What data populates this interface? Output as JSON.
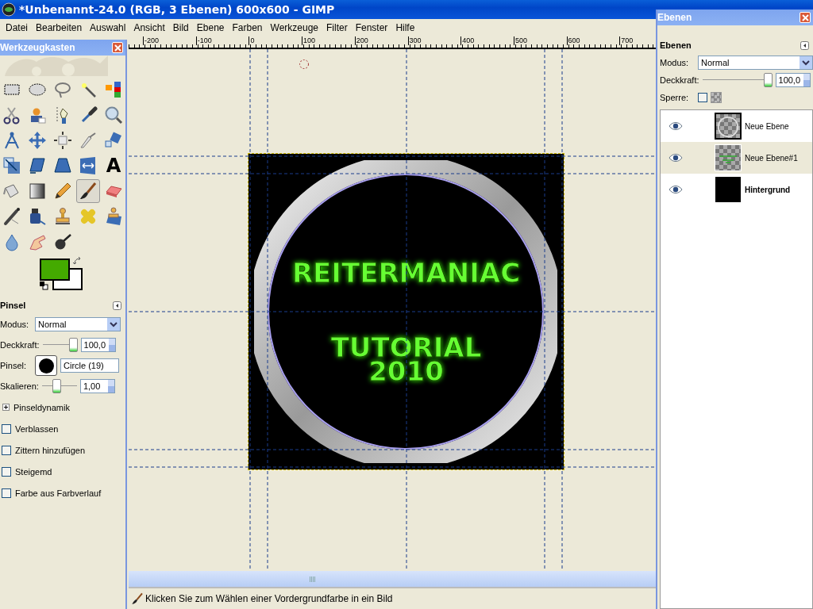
{
  "window": {
    "title": "*Unbenannt-24.0 (RGB, 3 Ebenen) 600x600 - GIMP"
  },
  "menu": [
    "Datei",
    "Bearbeiten",
    "Auswahl",
    "Ansicht",
    "Bild",
    "Ebene",
    "Farben",
    "Werkzeuge",
    "Filter",
    "Fenster",
    "Hilfe"
  ],
  "ruler": [
    "-200",
    "-100",
    "0",
    "100",
    "200",
    "300",
    "400",
    "500",
    "600",
    "700"
  ],
  "canvas": {
    "texts": [
      "REITERMANIAC",
      "TUTORIAL",
      "2010"
    ]
  },
  "status_bar": "Klicken Sie zum Wählen einer Vordergrundfarbe in ein Bild",
  "toolbox": {
    "title": "Werkzeugkasten",
    "tools": [
      {
        "selected": false
      },
      {
        "selected": false
      },
      {
        "selected": false
      },
      {
        "selected": false
      },
      {
        "selected": false
      },
      {
        "selected": false
      },
      {
        "selected": false
      },
      {
        "selected": false
      },
      {
        "selected": false
      },
      {
        "selected": false
      },
      {
        "selected": false
      },
      {
        "selected": false
      },
      {
        "selected": false
      },
      {
        "selected": false
      },
      {
        "selected": false
      },
      {
        "selected": false
      },
      {
        "selected": false
      },
      {
        "selected": false
      },
      {
        "selected": false
      },
      {
        "selected": false,
        "glyph": "A"
      },
      {
        "selected": false
      },
      {
        "selected": false
      },
      {
        "selected": false
      },
      {
        "selected": true
      },
      {
        "selected": false
      },
      {
        "selected": false
      },
      {
        "selected": false
      },
      {
        "selected": false
      },
      {
        "selected": false
      },
      {
        "selected": false
      },
      {
        "selected": false
      },
      {
        "selected": false
      },
      {
        "selected": false
      }
    ]
  },
  "tool_options": {
    "title": "Pinsel",
    "mode": {
      "label": "Modus:",
      "value": "Normal"
    },
    "opacity": {
      "label": "Deckkraft:",
      "level": 1,
      "value": "100,0"
    },
    "brush": {
      "label": "Pinsel:",
      "value": "Circle (19)"
    },
    "scale": {
      "label": "Skalieren:",
      "level": 0.4,
      "value": "1,00"
    },
    "dynamics": {
      "label": "Pinseldynamik",
      "expanded": false
    },
    "checkboxes": [
      {
        "label": "Verblassen",
        "checked": false
      },
      {
        "label": "Zittern hinzufügen",
        "checked": false
      },
      {
        "label": "Steigemd",
        "checked": false
      },
      {
        "label": "Farbe aus Farbverlauf",
        "checked": false
      }
    ]
  },
  "layers_dock": {
    "title": "Ebenen",
    "header": "Ebenen",
    "mode": {
      "label": "Modus:",
      "value": "Normal"
    },
    "opacity": {
      "label": "Deckkraft:",
      "level": 1,
      "value": "100,0"
    },
    "lock": {
      "label": "Sperre:",
      "pixels": false,
      "alpha": false
    },
    "layers": [
      {
        "name": "Neue Ebene",
        "visible": true,
        "selected": false,
        "active": true,
        "bold": false,
        "kind": "ring"
      },
      {
        "name": "Neue Ebene#1",
        "visible": true,
        "selected": true,
        "active": false,
        "bold": false,
        "kind": "text"
      },
      {
        "name": "Hintergrund",
        "visible": true,
        "selected": false,
        "active": false,
        "bold": true,
        "kind": "black"
      }
    ]
  }
}
